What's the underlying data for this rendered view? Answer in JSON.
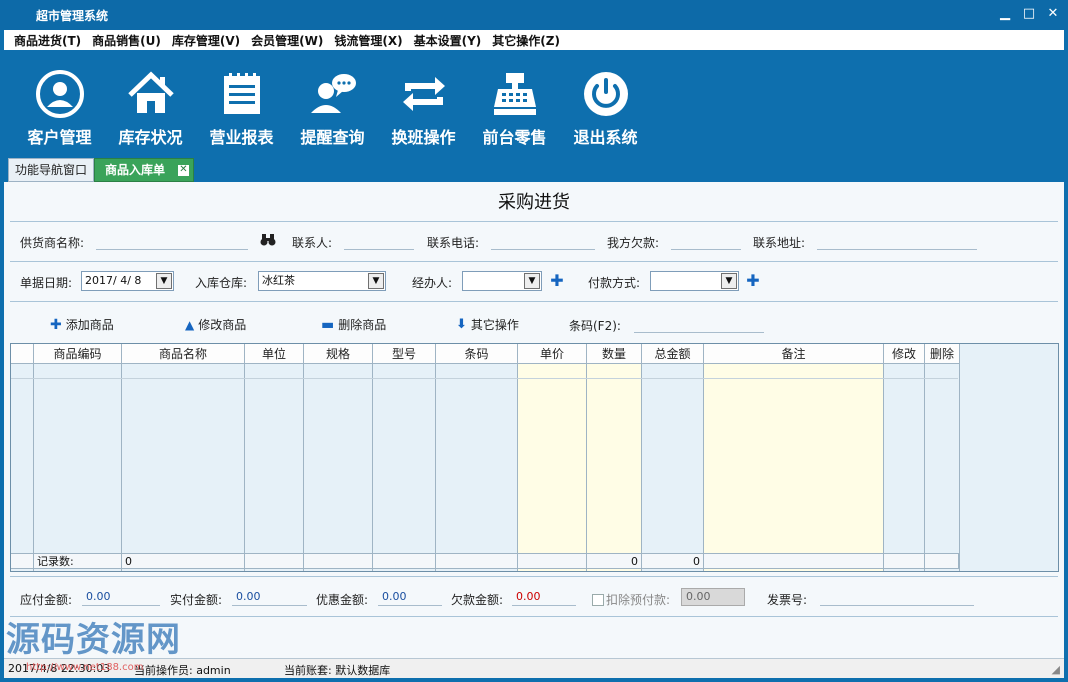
{
  "window": {
    "title": "超市管理系统"
  },
  "menu": [
    "商品进货(T)",
    "商品销售(U)",
    "库存管理(V)",
    "会员管理(W)",
    "钱流管理(X)",
    "基本设置(Y)",
    "其它操作(Z)"
  ],
  "toolbar": [
    {
      "label": "客户管理",
      "icon": "customer-icon"
    },
    {
      "label": "库存状况",
      "icon": "home-icon"
    },
    {
      "label": "营业报表",
      "icon": "report-icon"
    },
    {
      "label": "提醒查询",
      "icon": "chat-user-icon"
    },
    {
      "label": "换班操作",
      "icon": "swap-icon"
    },
    {
      "label": "前台零售",
      "icon": "cash-register-icon"
    },
    {
      "label": "退出系统",
      "icon": "power-icon"
    }
  ],
  "tabs": {
    "nav": "功能导航窗口",
    "active": "商品入库单"
  },
  "page": {
    "title": "采购进货"
  },
  "form": {
    "supplier_label": "供货商名称:",
    "contact_label": "联系人:",
    "phone_label": "联系电话:",
    "debt_label": "我方欠款:",
    "address_label": "联系地址:",
    "date_label": "单据日期:",
    "date_value": "2017/ 4/ 8",
    "warehouse_label": "入库仓库:",
    "warehouse_value": "冰红茶",
    "handler_label": "经办人:",
    "handler_value": "",
    "payment_label": "付款方式:",
    "payment_value": ""
  },
  "actions": {
    "add": "添加商品",
    "edit": "修改商品",
    "delete": "删除商品",
    "other": "其它操作",
    "barcode_label": "条码(F2):"
  },
  "grid": {
    "columns": [
      "商品编码",
      "商品名称",
      "单位",
      "规格",
      "型号",
      "条码",
      "单价",
      "数量",
      "总金额",
      "备注",
      "修改",
      "删除"
    ],
    "footer_label": "记录数:",
    "record_count": "0",
    "qty_total": "0",
    "amount_total": "0"
  },
  "totals": {
    "payable_label": "应付金额:",
    "payable_value": "0.00",
    "paid_label": "实付金额:",
    "paid_value": "0.00",
    "discount_label": "优惠金额:",
    "discount_value": "0.00",
    "owed_label": "欠款金额:",
    "owed_value": "0.00",
    "prepay_label": "扣除预付款:",
    "prepay_value": "0.00",
    "invoice_label": "发票号:"
  },
  "status": {
    "datetime": "2017/4/8 22:30:03",
    "operator": "当前操作员: admin",
    "account": "当前账套: 默认数据库"
  },
  "watermark": {
    "text": "源码资源网",
    "url": "http://www.net188.com"
  },
  "colors": {
    "titlebar": "#0d6aa8",
    "active_tab": "#3aa35a",
    "owed_value": "#cc0000",
    "value_text": "#1a4fa0"
  }
}
